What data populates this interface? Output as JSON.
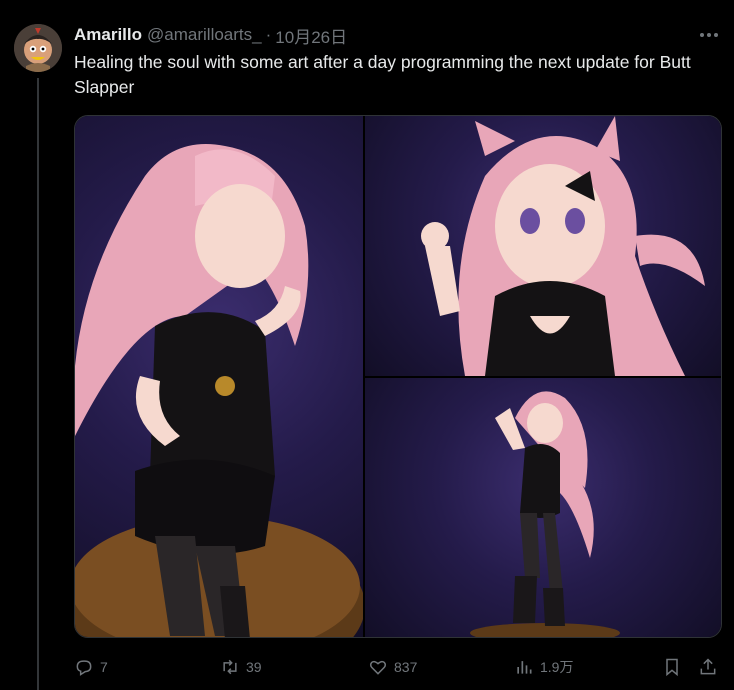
{
  "author": {
    "display_name": "Amarillo",
    "handle": "@amarilloarts_",
    "separator": "·",
    "date": "10月26日"
  },
  "tweet": {
    "text": "Healing the soul with some art after a day programming the next update for Butt Slapper"
  },
  "media": {
    "count": 3,
    "images": [
      {
        "icon": "image-full-figure"
      },
      {
        "icon": "image-closeup"
      },
      {
        "icon": "image-figure-on-base"
      }
    ]
  },
  "actions": {
    "reply_count": "7",
    "retweet_count": "39",
    "like_count": "837",
    "views_count": "1.9万"
  },
  "colors": {
    "background": "#000000",
    "text_primary": "#e7e9ea",
    "text_secondary": "#71767b",
    "border": "#2f3336",
    "image_bg": "#241b4a"
  }
}
